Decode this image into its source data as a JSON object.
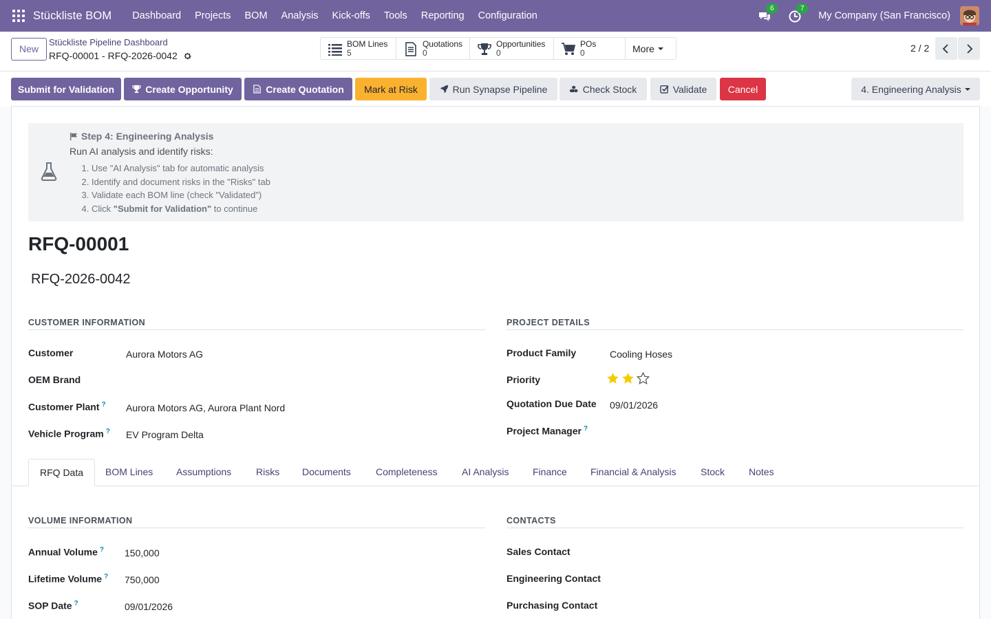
{
  "navbar": {
    "brand": "Stückliste BOM",
    "menu": [
      "Dashboard",
      "Projects",
      "BOM",
      "Analysis",
      "Kick-offs",
      "Tools",
      "Reporting",
      "Configuration"
    ],
    "messages_count": "6",
    "activities_count": "7",
    "company": "My Company (San Francisco)"
  },
  "control": {
    "new_label": "New",
    "breadcrumb_parent": "Stückliste Pipeline Dashboard",
    "breadcrumb_current": "RFQ-00001 - RFQ-2026-0042",
    "smart_buttons": [
      {
        "label": "BOM Lines",
        "value": "5",
        "icon": "list-icon"
      },
      {
        "label": "Quotations",
        "value": "0",
        "icon": "document-icon"
      },
      {
        "label": "Opportunities",
        "value": "0",
        "icon": "trophy-icon"
      },
      {
        "label": "POs",
        "value": "0",
        "icon": "cart-icon"
      }
    ],
    "more_label": "More",
    "pager": "2 / 2"
  },
  "statusbar": {
    "submit": "Submit for Validation",
    "create_opportunity": "Create Opportunity",
    "create_quotation": "Create Quotation",
    "mark_at_risk": "Mark at Risk",
    "run_pipeline": "Run Synapse Pipeline",
    "check_stock": "Check Stock",
    "validate": "Validate",
    "cancel": "Cancel",
    "stage": "4. Engineering Analysis"
  },
  "alert": {
    "title": "Step 4: Engineering Analysis",
    "desc": "Run AI analysis and identify risks:",
    "steps": [
      "Use \"AI Analysis\" tab for automatic analysis",
      "Identify and document risks in the \"Risks\" tab",
      "Validate each BOM line (check \"Validated\")"
    ],
    "step4_prefix": "Click ",
    "step4_bold": "\"Submit for Validation\"",
    "step4_suffix": " to continue"
  },
  "record": {
    "name": "RFQ-00001",
    "reference": "RFQ-2026-0042"
  },
  "customer_info": {
    "heading": "CUSTOMER INFORMATION",
    "customer_label": "Customer",
    "customer": "Aurora Motors AG",
    "oem_label": "OEM Brand",
    "plant_label": "Customer Plant",
    "plant": "Aurora Motors AG, Aurora Plant Nord",
    "vehicle_label": "Vehicle Program",
    "vehicle": "EV Program Delta"
  },
  "project_details": {
    "heading": "PROJECT DETAILS",
    "family_label": "Product Family",
    "family": "Cooling Hoses",
    "priority_label": "Priority",
    "priority_stars": 2,
    "priority_max": 3,
    "due_label": "Quotation Due Date",
    "due": "09/01/2026",
    "pm_label": "Project Manager"
  },
  "tabs": [
    "RFQ Data",
    "BOM Lines",
    "Assumptions",
    "Risks",
    "Documents",
    "Completeness",
    "AI Analysis",
    "Finance",
    "Financial & Analysis",
    "Stock",
    "Notes"
  ],
  "volume": {
    "heading": "VOLUME INFORMATION",
    "annual_label": "Annual Volume",
    "annual": "150,000",
    "lifetime_label": "Lifetime Volume",
    "lifetime": "750,000",
    "sop_label": "SOP Date",
    "sop": "09/01/2026"
  },
  "contacts": {
    "heading": "CONTACTS",
    "sales_label": "Sales Contact",
    "engineering_label": "Engineering Contact",
    "purchasing_label": "Purchasing Contact"
  },
  "colors": {
    "brand": "#71639e",
    "warning": "#fbb130",
    "danger": "#dc3545",
    "star": "#f3cc00"
  }
}
